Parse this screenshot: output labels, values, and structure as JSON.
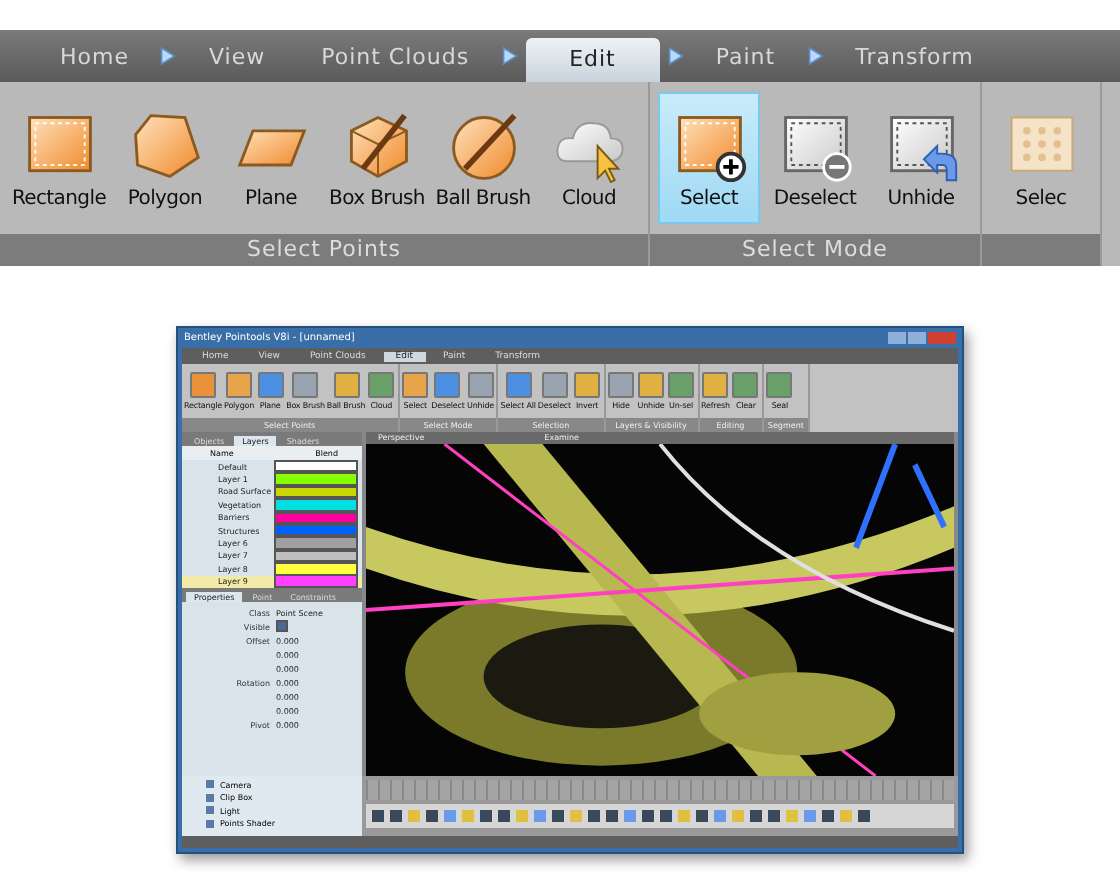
{
  "ribbon": {
    "tabs": [
      {
        "label": "Home",
        "selected": false,
        "arrow": true
      },
      {
        "label": "View",
        "selected": false,
        "arrow": false
      },
      {
        "label": "Point Clouds",
        "selected": false,
        "arrow": true
      },
      {
        "label": "Edit",
        "selected": true,
        "arrow": true
      },
      {
        "label": "Paint",
        "selected": false,
        "arrow": true
      },
      {
        "label": "Transform",
        "selected": false,
        "arrow": false
      }
    ],
    "groups": [
      {
        "label": "Select Points",
        "buttons": [
          {
            "label": "Rectangle",
            "kind": "rect",
            "selected": false
          },
          {
            "label": "Polygon",
            "kind": "polygon",
            "selected": false
          },
          {
            "label": "Plane",
            "kind": "plane",
            "selected": false
          },
          {
            "label": "Box Brush",
            "kind": "box",
            "selected": false
          },
          {
            "label": "Ball Brush",
            "kind": "ball",
            "selected": false
          },
          {
            "label": "Cloud",
            "kind": "cloud",
            "selected": false
          }
        ]
      },
      {
        "label": "Select Mode",
        "buttons": [
          {
            "label": "Select",
            "kind": "select",
            "selected": true
          },
          {
            "label": "Deselect",
            "kind": "deselect",
            "selected": false
          },
          {
            "label": "Unhide",
            "kind": "unhide",
            "selected": false
          }
        ]
      },
      {
        "buttons": [
          {
            "label": "Selec",
            "kind": "grid",
            "selected": false
          }
        ]
      }
    ]
  },
  "app": {
    "title": "Bentley Pointools V8i - [unnamed]",
    "tabs": [
      {
        "label": "Home",
        "selected": false
      },
      {
        "label": "View",
        "selected": false
      },
      {
        "label": "Point Clouds",
        "selected": false
      },
      {
        "label": "Edit",
        "selected": true
      },
      {
        "label": "Paint",
        "selected": false
      },
      {
        "label": "Transform",
        "selected": false
      }
    ],
    "groups": [
      {
        "label": "Select Points",
        "buttons": [
          "Rectangle",
          "Polygon",
          "Plane",
          "Box Brush",
          "Ball Brush",
          "Cloud"
        ]
      },
      {
        "label": "Select Mode",
        "buttons": [
          "Select",
          "Deselect",
          "Unhide"
        ]
      },
      {
        "label": "Selection",
        "buttons": [
          "Select All",
          "Deselect",
          "Invert"
        ]
      },
      {
        "label": "Layers & Visibility",
        "buttons": [
          "Hide",
          "Unhide",
          "Un-sel"
        ]
      },
      {
        "label": "Editing",
        "buttons": [
          "Refresh",
          "Clear"
        ]
      },
      {
        "label": "Segment",
        "buttons": [
          "Seal"
        ]
      }
    ],
    "panel_tabs": [
      {
        "label": "Objects",
        "selected": false
      },
      {
        "label": "Layers",
        "selected": true
      },
      {
        "label": "Shaders",
        "selected": false
      }
    ],
    "layer_header": {
      "name": "Name",
      "blend": "Blend"
    },
    "layers": [
      {
        "name": "Default",
        "color": "#ffffff",
        "selected": false
      },
      {
        "name": "Layer 1",
        "color": "#88ff00",
        "selected": false
      },
      {
        "name": "Road Surface",
        "color": "#c8d800",
        "selected": false
      },
      {
        "name": "Vegetation",
        "color": "#00e0e0",
        "selected": false
      },
      {
        "name": "Barriers",
        "color": "#ff00a0",
        "selected": false
      },
      {
        "name": "Structures",
        "color": "#0060ff",
        "selected": false
      },
      {
        "name": "Layer 6",
        "color": "#a0a0a0",
        "selected": false
      },
      {
        "name": "Layer 7",
        "color": "#c0c0c0",
        "selected": false
      },
      {
        "name": "Layer 8",
        "color": "#ffff40",
        "selected": false
      },
      {
        "name": "Layer 9",
        "color": "#ff40ff",
        "selected": true
      }
    ],
    "prop_tabs": [
      {
        "label": "Properties",
        "selected": true
      },
      {
        "label": "Point",
        "selected": false
      },
      {
        "label": "Constraints",
        "selected": false
      }
    ],
    "properties": [
      {
        "label": "Class",
        "value": "Point Scene"
      },
      {
        "label": "Visible",
        "kind": "checkbox",
        "checked": true
      },
      {
        "label": "Offset",
        "value": "0.000"
      },
      {
        "value": "0.000"
      },
      {
        "value": "0.000"
      },
      {
        "label": "Rotation",
        "value": "0.000"
      },
      {
        "value": "0.000"
      },
      {
        "value": "0.000"
      },
      {
        "label": "Pivot",
        "value": "0.000"
      }
    ],
    "viewports": [
      "Perspective",
      "Examine"
    ],
    "objects": [
      "Camera",
      "Clip Box",
      "Light",
      "Points Shader"
    ]
  }
}
